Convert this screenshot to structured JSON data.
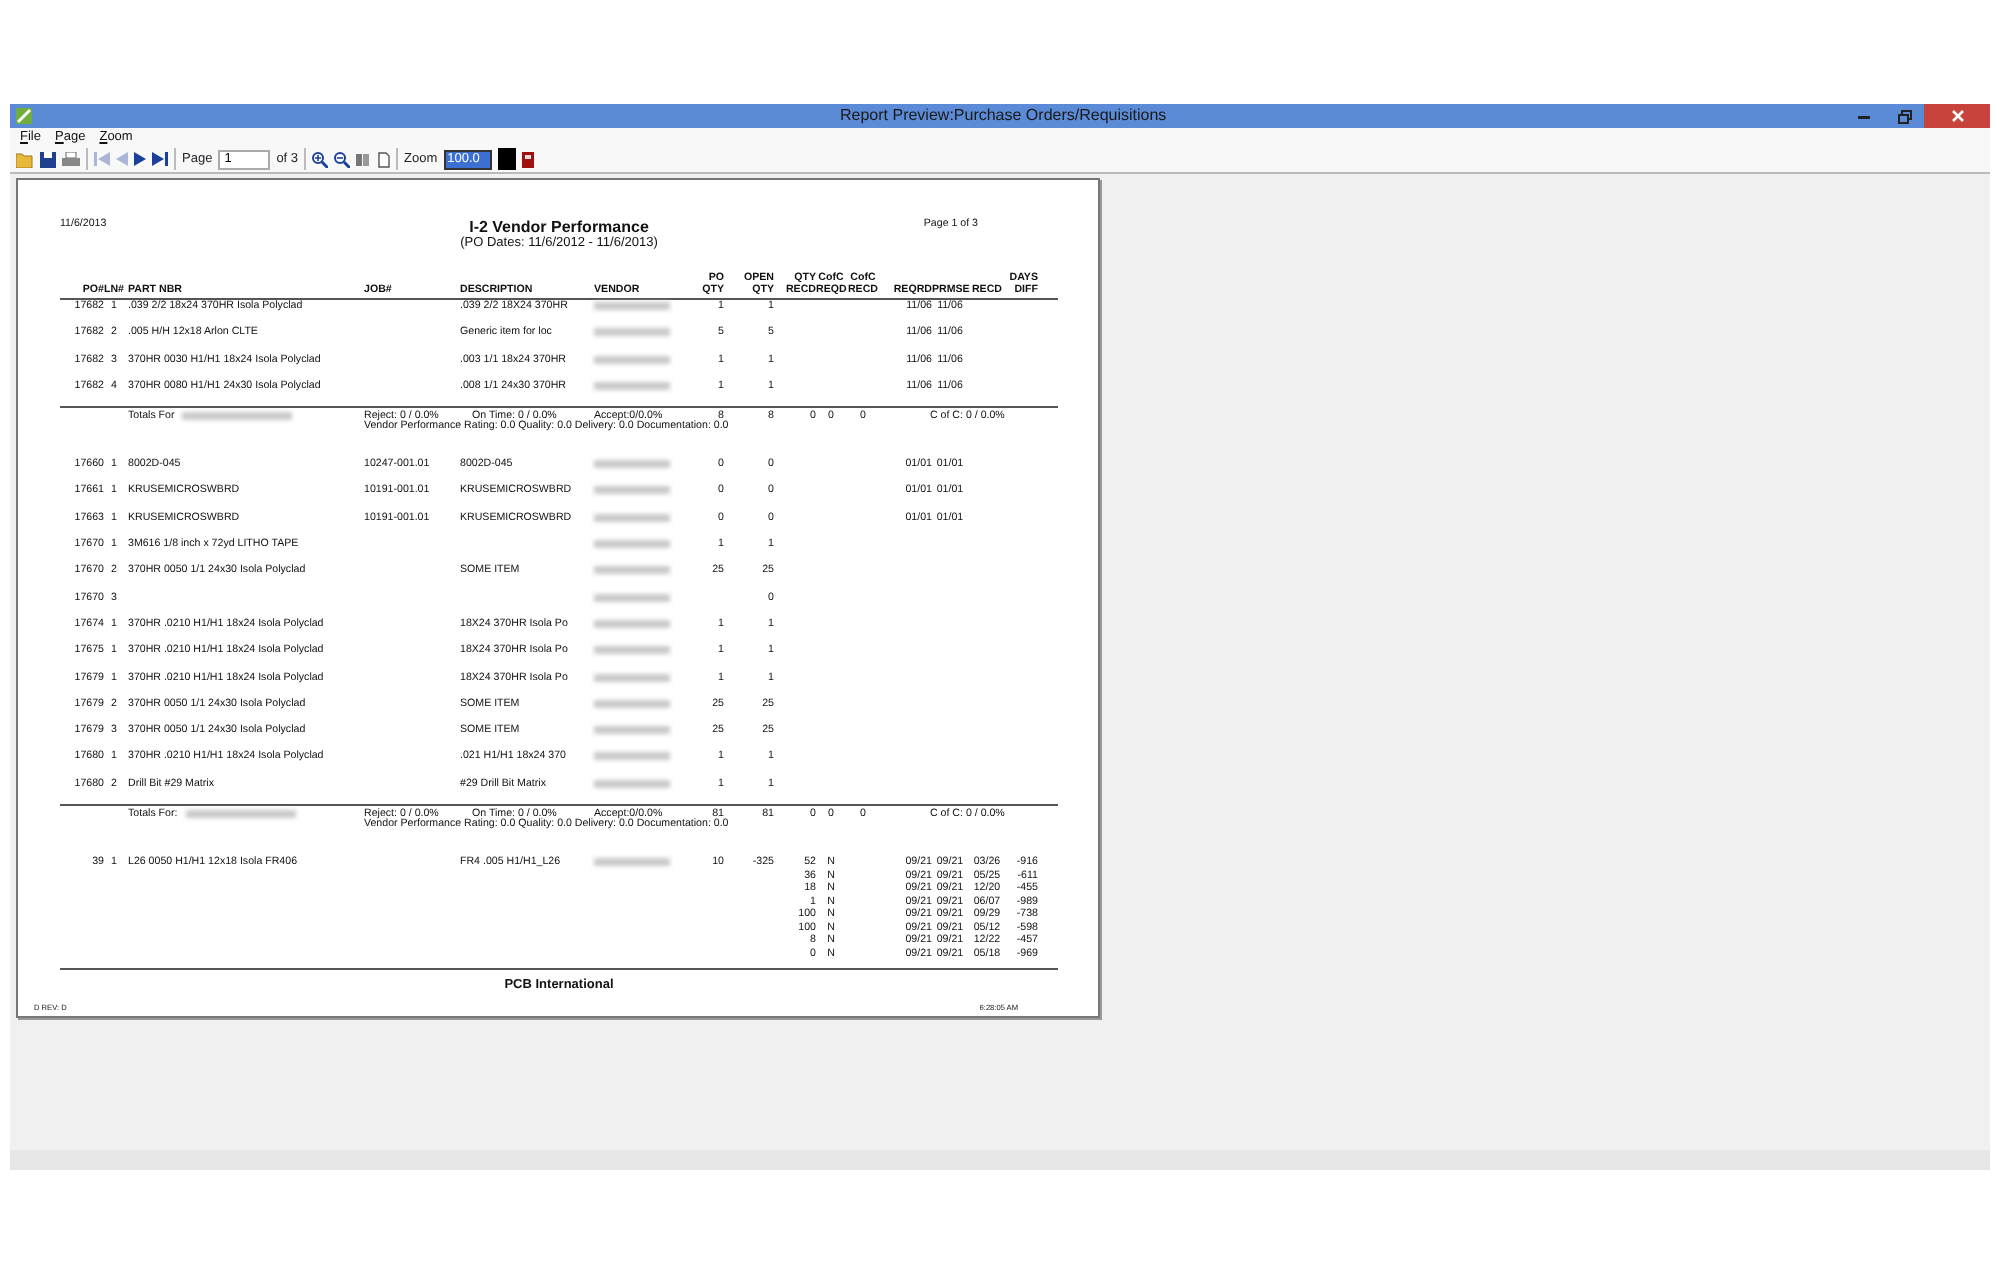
{
  "window": {
    "title": "Report Preview:Purchase Orders/Requisitions"
  },
  "menu": [
    "File",
    "Page",
    "Zoom"
  ],
  "toolbar": {
    "first_disabled": true,
    "prev_disabled": true,
    "page_label": "Page",
    "page_value": "1",
    "page_of": "of 3",
    "zoom_label": "Zoom",
    "zoom_value": "100.0"
  },
  "report": {
    "date": "11/6/2013",
    "title": "I-2 Vendor Performance",
    "subtitle": "(PO Dates:  11/6/2012  -  11/6/2013)",
    "page": "Page 1 of 3",
    "columns": [
      [
        "",
        "PO#"
      ],
      [
        "",
        "LN#"
      ],
      [
        "",
        "PART NBR"
      ],
      [
        "",
        "JOB#"
      ],
      [
        "",
        "DESCRIPTION"
      ],
      [
        "",
        "VENDOR"
      ],
      [
        "PO",
        "QTY"
      ],
      [
        "OPEN",
        "QTY"
      ],
      [
        "QTY",
        "RECD"
      ],
      [
        "CofC",
        "REQD"
      ],
      [
        "CofC",
        "RECD"
      ],
      [
        "",
        "REQRD"
      ],
      [
        "",
        "PRMSE"
      ],
      [
        "",
        "RECD"
      ],
      [
        "DAYS",
        "DIFF"
      ]
    ],
    "groups": [
      {
        "rows": [
          {
            "po": "17682",
            "ln": "1",
            "part": ".039 2/2 18x24 370HR Isola Polyclad",
            "desc": ".039 2/2 18X24 370HR",
            "vendor_redacted": true,
            "po_qty": "1",
            "open_qty": "1",
            "reqrd": "11/06",
            "prmse": "11/06"
          },
          {
            "po": "17682",
            "ln": "2",
            "part": ".005 H/H 12x18 Arlon CLTE",
            "desc": "Generic item for loc",
            "vendor_redacted": true,
            "po_qty": "5",
            "open_qty": "5",
            "reqrd": "11/06",
            "prmse": "11/06"
          },
          {
            "po": "17682",
            "ln": "3",
            "part": "370HR 0030 H1/H1 18x24 Isola Polyclad",
            "desc": ".003 1/1 18x24 370HR",
            "vendor_redacted": true,
            "po_qty": "1",
            "open_qty": "1",
            "reqrd": "11/06",
            "prmse": "11/06"
          },
          {
            "po": "17682",
            "ln": "4",
            "part": "370HR 0080 H1/H1 24x30 Isola Polyclad",
            "desc": ".008 1/1 24x30 370HR",
            "vendor_redacted": true,
            "po_qty": "1",
            "open_qty": "1",
            "reqrd": "11/06",
            "prmse": "11/06"
          }
        ],
        "totals": {
          "label": "Totals For",
          "vendor_redacted": true,
          "reject": "Reject: 0 / 0.0%",
          "on_time": "On Time: 0 / 0.0%",
          "accept": "Accept:0/0.0%",
          "po_qty": "8",
          "open_qty": "8",
          "qty_recd": "0",
          "cofc_reqd": "0",
          "cofc_recd": "0",
          "cofc": "C of C: 0 / 0.0%"
        },
        "rating": "Vendor Performance Rating: 0.0 Quality: 0.0 Delivery: 0.0 Documentation: 0.0"
      },
      {
        "rows": [
          {
            "po": "17660",
            "ln": "1",
            "part": "8002D-045",
            "job": "10247-001.01",
            "desc": "8002D-045",
            "vendor_redacted": true,
            "po_qty": "0",
            "open_qty": "0",
            "reqrd": "01/01",
            "prmse": "01/01"
          },
          {
            "po": "17661",
            "ln": "1",
            "part": "KRUSEMICROSWBRD",
            "job": "10191-001.01",
            "desc": "KRUSEMICROSWBRD",
            "vendor_redacted": true,
            "po_qty": "0",
            "open_qty": "0",
            "reqrd": "01/01",
            "prmse": "01/01"
          },
          {
            "po": "17663",
            "ln": "1",
            "part": "KRUSEMICROSWBRD",
            "job": "10191-001.01",
            "desc": "KRUSEMICROSWBRD",
            "vendor_redacted": true,
            "po_qty": "0",
            "open_qty": "0",
            "reqrd": "01/01",
            "prmse": "01/01"
          },
          {
            "po": "17670",
            "ln": "1",
            "part": "3M616 1/8 inch x 72yd  LITHO TAPE",
            "vendor_redacted": true,
            "po_qty": "1",
            "open_qty": "1"
          },
          {
            "po": "17670",
            "ln": "2",
            "part": "370HR 0050 1/1 24x30 Isola Polyclad",
            "desc": "SOME   ITEM",
            "vendor_redacted": true,
            "po_qty": "25",
            "open_qty": "25"
          },
          {
            "po": "17670",
            "ln": "3",
            "vendor_redacted": true,
            "open_qty": "0"
          },
          {
            "po": "17674",
            "ln": "1",
            "part": "370HR .0210 H1/H1 18x24 Isola Polyclad",
            "desc": "18X24 370HR Isola Po",
            "vendor_redacted": true,
            "po_qty": "1",
            "open_qty": "1"
          },
          {
            "po": "17675",
            "ln": "1",
            "part": "370HR .0210 H1/H1 18x24 Isola Polyclad",
            "desc": "18X24 370HR Isola Po",
            "vendor_redacted": true,
            "po_qty": "1",
            "open_qty": "1"
          },
          {
            "po": "17679",
            "ln": "1",
            "part": "370HR .0210 H1/H1 18x24 Isola Polyclad",
            "desc": "18X24 370HR Isola Po",
            "vendor_redacted": true,
            "po_qty": "1",
            "open_qty": "1"
          },
          {
            "po": "17679",
            "ln": "2",
            "part": "370HR 0050 1/1 24x30 Isola Polyclad",
            "desc": "SOME   ITEM",
            "vendor_redacted": true,
            "po_qty": "25",
            "open_qty": "25"
          },
          {
            "po": "17679",
            "ln": "3",
            "part": "370HR 0050 1/1 24x30 Isola Polyclad",
            "desc": "SOME   ITEM",
            "vendor_redacted": true,
            "po_qty": "25",
            "open_qty": "25"
          },
          {
            "po": "17680",
            "ln": "1",
            "part": "370HR .0210 H1/H1 18x24 Isola Polyclad",
            "desc": ".021 H1/H1 18x24 370",
            "vendor_redacted": true,
            "po_qty": "1",
            "open_qty": "1"
          },
          {
            "po": "17680",
            "ln": "2",
            "part": "Drill Bit #29 Matrix",
            "desc": "#29 Drill Bit Matrix",
            "vendor_redacted": true,
            "po_qty": "1",
            "open_qty": "1"
          }
        ],
        "totals": {
          "label": "Totals  For:",
          "vendor_redacted": true,
          "reject": "Reject: 0 / 0.0%",
          "on_time": "On Time: 0 / 0.0%",
          "accept": "Accept:0/0.0%",
          "po_qty": "81",
          "open_qty": "81",
          "qty_recd": "0",
          "cofc_reqd": "0",
          "cofc_recd": "0",
          "cofc": "C of C: 0 / 0.0%"
        },
        "rating": "Vendor Performance Rating: 0.0 Quality: 0.0 Delivery: 0.0 Documentation: 0.0"
      },
      {
        "rows": [
          {
            "po": "39",
            "ln": "1",
            "part": "L26 0050 H1/H1 12x18 Isola FR406",
            "desc": "FR4 .005 H1/H1_L26",
            "vendor_redacted": true,
            "po_qty": "10",
            "open_qty": "-325",
            "receipts": [
              {
                "qty_recd": "52",
                "cofc_reqd": "N",
                "reqrd": "09/21",
                "prmse": "09/21",
                "recd": "03/26",
                "days_diff": "-916"
              },
              {
                "qty_recd": "36",
                "cofc_reqd": "N",
                "reqrd": "09/21",
                "prmse": "09/21",
                "recd": "05/25",
                "days_diff": "-611"
              },
              {
                "qty_recd": "18",
                "cofc_reqd": "N",
                "reqrd": "09/21",
                "prmse": "09/21",
                "recd": "12/20",
                "days_diff": "-455"
              },
              {
                "qty_recd": "1",
                "cofc_reqd": "N",
                "reqrd": "09/21",
                "prmse": "09/21",
                "recd": "06/07",
                "days_diff": "-989"
              },
              {
                "qty_recd": "100",
                "cofc_reqd": "N",
                "reqrd": "09/21",
                "prmse": "09/21",
                "recd": "09/29",
                "days_diff": "-738"
              },
              {
                "qty_recd": "100",
                "cofc_reqd": "N",
                "reqrd": "09/21",
                "prmse": "09/21",
                "recd": "05/12",
                "days_diff": "-598"
              },
              {
                "qty_recd": "8",
                "cofc_reqd": "N",
                "reqrd": "09/21",
                "prmse": "09/21",
                "recd": "12/22",
                "days_diff": "-457"
              },
              {
                "qty_recd": "0",
                "cofc_reqd": "N",
                "reqrd": "09/21",
                "prmse": "09/21",
                "recd": "05/18",
                "days_diff": "-969"
              }
            ]
          }
        ]
      }
    ],
    "company": "PCB International",
    "revision": "D REV: D",
    "time": "6:28:05 AM"
  }
}
